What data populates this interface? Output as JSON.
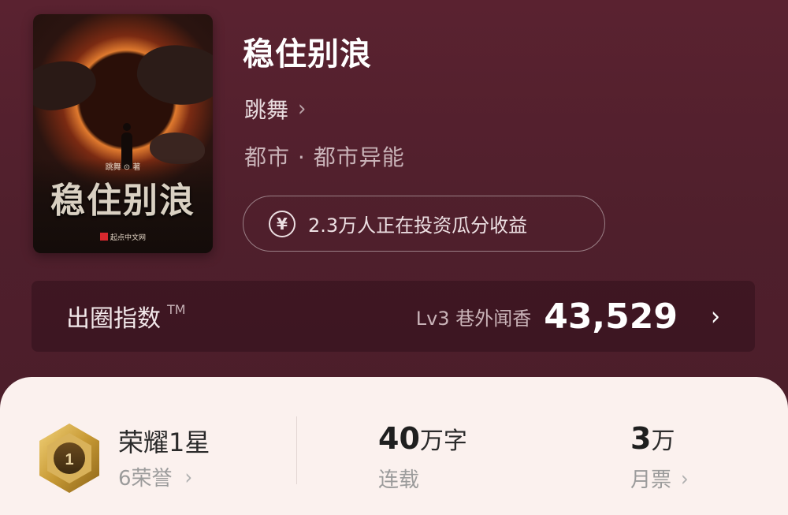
{
  "book": {
    "title": "稳住别浪",
    "author": "跳舞",
    "genre": "都市 · 都市异能",
    "invest_text": "2.3万人正在投资瓜分收益"
  },
  "cover": {
    "title": "稳住别浪",
    "author": "跳舞 ⊙ 著",
    "publisher": "起点中文网"
  },
  "index": {
    "label": "出圈指数",
    "tm": "TM",
    "level": "Lv3 巷外闻香",
    "score": "43,529"
  },
  "honor": {
    "title": "荣耀1星",
    "count": "6荣誉",
    "badge_number": "1"
  },
  "stats": {
    "words_value": "40",
    "words_unit": "万字",
    "words_status": "连载",
    "tickets_value": "3",
    "tickets_unit": "万",
    "tickets_label": "月票"
  },
  "icons": {
    "chevron": "chevron-right-icon",
    "yen": "yen-icon",
    "badge": "honor-badge-icon"
  }
}
